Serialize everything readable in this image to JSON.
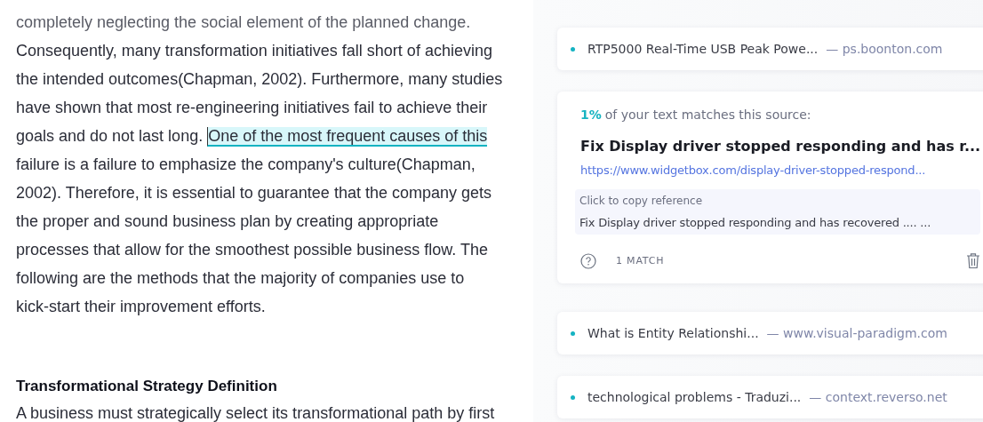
{
  "document": {
    "paragraph": [
      [
        {
          "text": "completely neglecting the social element of the planned change.",
          "highlighted": false
        }
      ],
      [
        {
          "text": "Consequently, many transformation initiatives fall short of achieving",
          "highlighted": false
        }
      ],
      [
        {
          "text": "the intended outcomes(Chapman, 2002). Furthermore, many studies",
          "highlighted": false
        }
      ],
      [
        {
          "text": "have shown that most re-engineering initiatives fail to achieve their",
          "highlighted": false
        }
      ],
      [
        {
          "text": "goals and do not last long. ",
          "highlighted": false
        },
        {
          "text": "One of the most frequent causes of this",
          "highlighted": true
        }
      ],
      [
        {
          "text": "failure is a failure to emphasize the company's culture(Chapman,",
          "highlighted": false
        }
      ],
      [
        {
          "text": "2002). Therefore, it is essential to guarantee that the company gets",
          "highlighted": false
        }
      ],
      [
        {
          "text": "the proper and sound business plan by creating appropriate",
          "highlighted": false
        }
      ],
      [
        {
          "text": "processes that allow for the smoothest possible business flow. The",
          "highlighted": false
        }
      ],
      [
        {
          "text": "following are the methods that the majority of companies use to",
          "highlighted": false
        }
      ],
      [
        {
          "text": "kick-start their improvement efforts.",
          "highlighted": false
        }
      ]
    ],
    "heading": "Transformational Strategy Definition",
    "next_line": "A business must strategically select its transformational path by first"
  },
  "sources": [
    {
      "kind": "collapsed",
      "title": "RTP5000 Real-Time USB Peak Powe...",
      "domain": "— ps.boonton.com"
    },
    {
      "kind": "expanded",
      "percent": "1%",
      "match_text": "of your text matches this source:",
      "title": "Fix Display driver stopped responding and has r...",
      "url": "https://www.widgetbox.com/display-driver-stopped-respond...",
      "reference_label": "Click to copy reference",
      "reference": "Fix Display driver stopped responding and has recovered .... ...",
      "matches": "1 MATCH"
    },
    {
      "kind": "collapsed",
      "title": "What is Entity Relationshi...",
      "domain": "— www.visual-paradigm.com"
    },
    {
      "kind": "collapsed",
      "title": "technological problems - Traduzi...",
      "domain": "— context.reverso.net"
    }
  ]
}
